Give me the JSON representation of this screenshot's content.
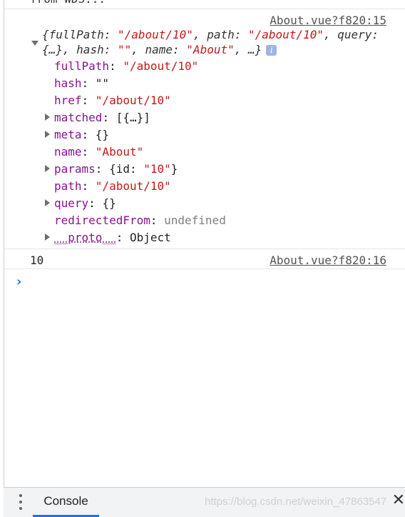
{
  "top_truncated_text": "from WDS...",
  "log1": {
    "source": "About.vue?f820:15",
    "summary_part1": [
      {
        "t": "{",
        "c": "k-italic"
      },
      {
        "t": "fullPath",
        "c": "k-italic"
      },
      {
        "t": ": ",
        "c": "k-italic"
      },
      {
        "t": "\"/about/10\"",
        "c": "str"
      },
      {
        "t": ", ",
        "c": "k-italic"
      },
      {
        "t": "path",
        "c": "k-italic"
      },
      {
        "t": ": ",
        "c": "k-italic"
      },
      {
        "t": "\"/about/10\"",
        "c": "str"
      },
      {
        "t": ", ",
        "c": "k-italic"
      },
      {
        "t": "query",
        "c": "k-italic"
      },
      {
        "t": ":",
        "c": "k-italic"
      }
    ],
    "summary_part2": [
      {
        "t": "{…}",
        "c": "k-italic"
      },
      {
        "t": ", ",
        "c": "k-italic"
      },
      {
        "t": "hash",
        "c": "k-italic"
      },
      {
        "t": ": ",
        "c": "k-italic"
      },
      {
        "t": "\"\"",
        "c": "str"
      },
      {
        "t": ", ",
        "c": "k-italic"
      },
      {
        "t": "name",
        "c": "k-italic"
      },
      {
        "t": ": ",
        "c": "k-italic"
      },
      {
        "t": "\"About\"",
        "c": "str"
      },
      {
        "t": ", …}",
        "c": "k-italic"
      }
    ],
    "info_badge": "i",
    "props": [
      {
        "key": "fullPath",
        "value": "\"/about/10\"",
        "vclass": "str",
        "expandable": false
      },
      {
        "key": "hash",
        "value": "\"\"",
        "vclass": "plain",
        "expandable": false
      },
      {
        "key": "href",
        "value": "\"/about/10\"",
        "vclass": "str",
        "expandable": false
      },
      {
        "key": "matched",
        "value": "[{…}]",
        "vclass": "plain",
        "expandable": true
      },
      {
        "key": "meta",
        "value": "{}",
        "vclass": "plain",
        "expandable": true
      },
      {
        "key": "name",
        "value": "\"About\"",
        "vclass": "str",
        "expandable": false
      },
      {
        "key": "params",
        "value_parts": [
          {
            "t": "{id: ",
            "c": "plain"
          },
          {
            "t": "\"10\"",
            "c": "str"
          },
          {
            "t": "}",
            "c": "plain"
          }
        ],
        "expandable": true
      },
      {
        "key": "path",
        "value": "\"/about/10\"",
        "vclass": "str",
        "expandable": false
      },
      {
        "key": "query",
        "value": "{}",
        "vclass": "plain",
        "expandable": true
      },
      {
        "key": "redirectedFrom",
        "value": "undefined",
        "vclass": "nul",
        "expandable": false
      },
      {
        "key": "__proto__",
        "value": "Object",
        "vclass": "plain",
        "expandable": true,
        "underline": true
      }
    ]
  },
  "log2": {
    "value": "10",
    "source": "About.vue?f820:16"
  },
  "prompt_symbol": "›",
  "bottom_bar": {
    "menu_icon": "kebab-menu-icon",
    "tab_label": "Console",
    "watermark": "https://blog.csdn.net/weixin_47863547",
    "close_symbol": "✕"
  },
  "colors": {
    "string": "#c41a16",
    "key": "#881391",
    "undefined": "#808080",
    "accent": "#1a73e8"
  }
}
